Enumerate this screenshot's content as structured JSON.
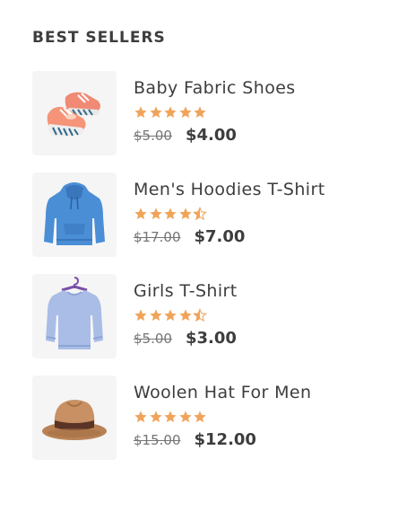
{
  "widget": {
    "title": "BEST SELLERS"
  },
  "colors": {
    "star": "#f0a45a",
    "text": "#3d3d3d",
    "old_price": "#757575",
    "thumb_bg": "#f5f5f5"
  },
  "products": [
    {
      "name": "Baby Fabric Shoes",
      "image_icon": "baby-shoes-icon",
      "rating": 5,
      "old_price": "$5.00",
      "price": "$4.00"
    },
    {
      "name": "Men's Hoodies T-Shirt",
      "image_icon": "hoodie-icon",
      "rating": 4.5,
      "old_price": "$17.00",
      "price": "$7.00"
    },
    {
      "name": "Girls T-Shirt",
      "image_icon": "sweater-icon",
      "rating": 4.5,
      "old_price": "$5.00",
      "price": "$3.00"
    },
    {
      "name": "Woolen Hat For Men",
      "image_icon": "hat-icon",
      "rating": 5,
      "old_price": "$15.00",
      "price": "$12.00"
    }
  ]
}
